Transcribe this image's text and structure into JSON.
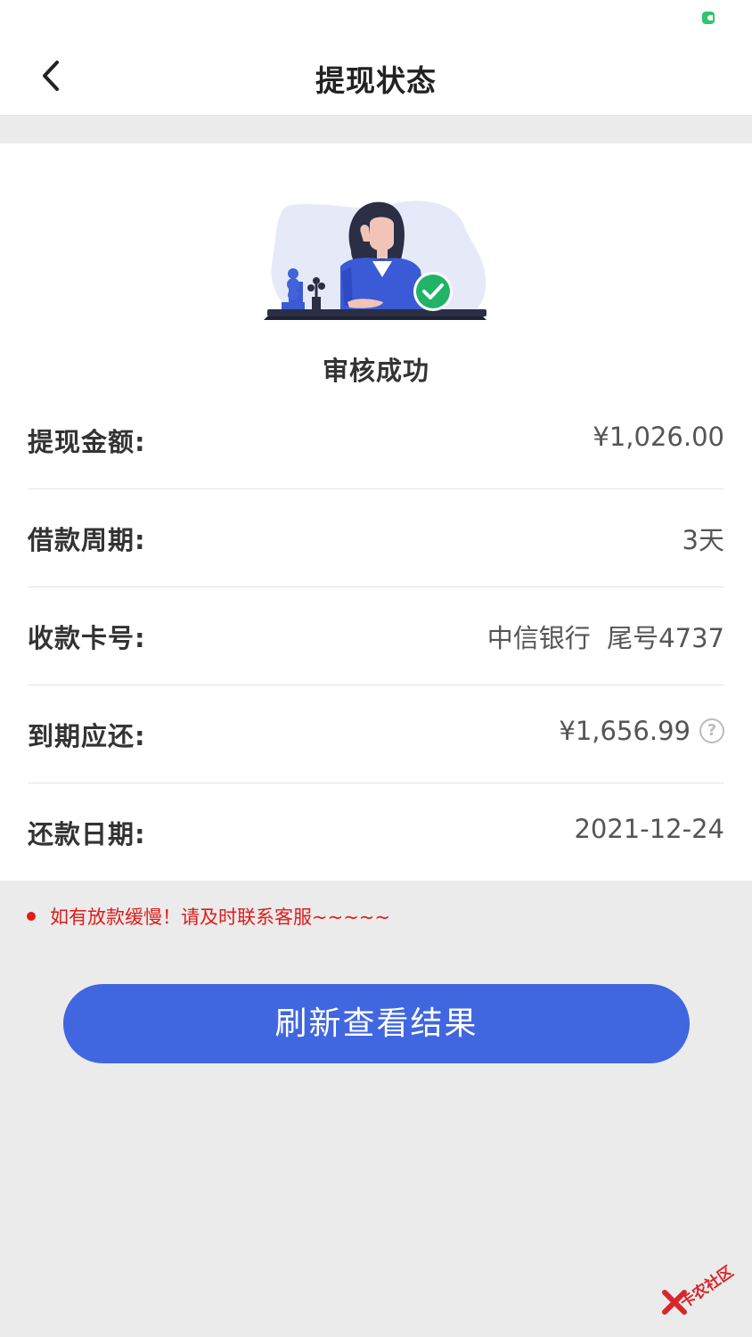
{
  "header": {
    "title": "提现状态"
  },
  "status": {
    "label": "审核成功"
  },
  "details": [
    {
      "label": "提现金额:",
      "value": "¥1,026.00"
    },
    {
      "label": "借款周期:",
      "value": "3天"
    },
    {
      "label": "收款卡号:",
      "value": "中信银行  尾号4737"
    },
    {
      "label": "到期应还:",
      "value": "¥1,656.99"
    },
    {
      "label": "还款日期:",
      "value": "2021-12-24"
    }
  ],
  "help_icon": {
    "glyph": "?"
  },
  "notice": {
    "text": "如有放款缓慢！请及时联系客服~~~~~"
  },
  "actions": {
    "refresh_label": "刷新查看结果"
  },
  "watermark": {
    "text": "卡农社区"
  },
  "colors": {
    "primary_button": "#4066e0",
    "notice_red": "#e11b1b",
    "success_green": "#21b366",
    "page_background": "#ebebeb"
  }
}
